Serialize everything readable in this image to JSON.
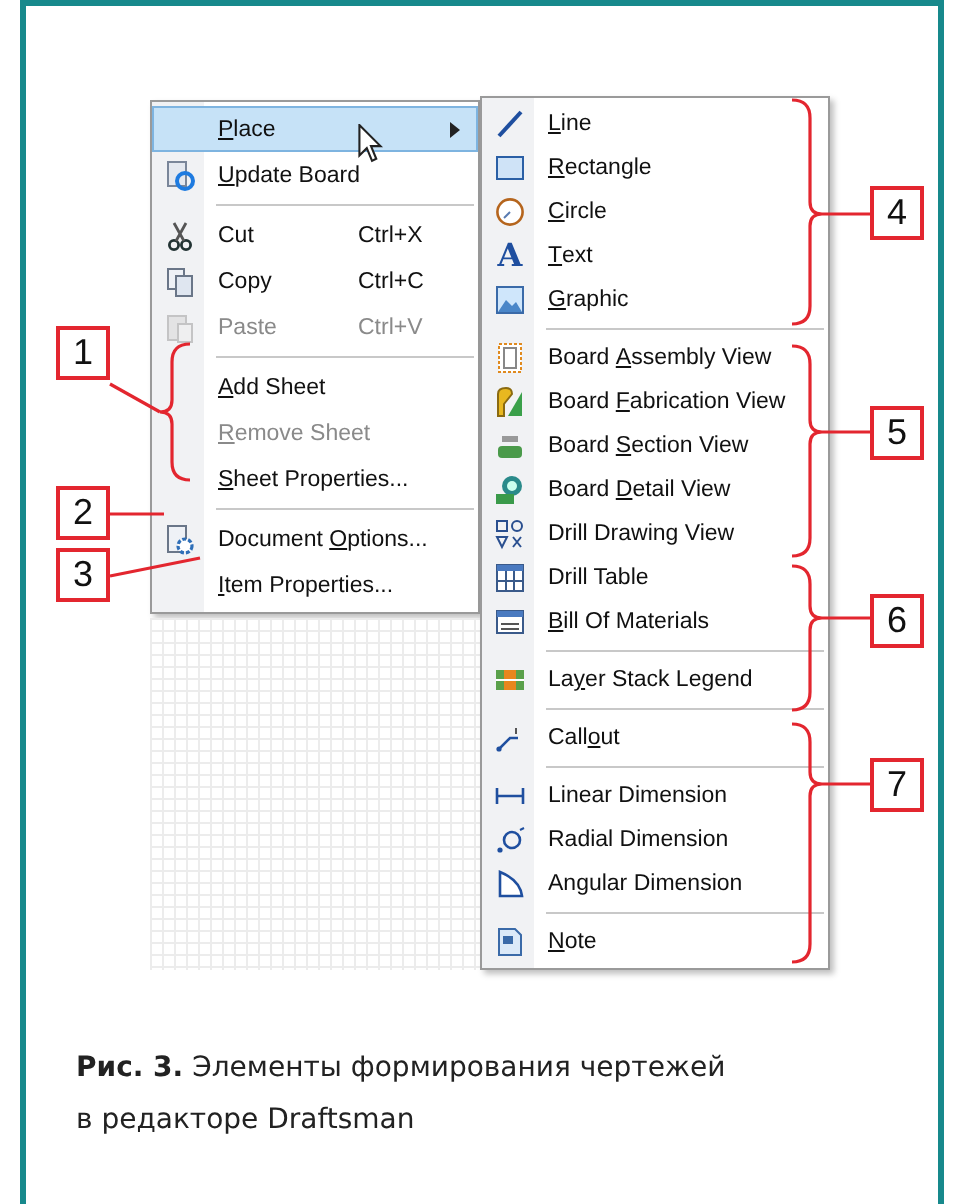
{
  "main_menu": {
    "items": [
      {
        "kind": "item",
        "key": "P",
        "post": "lace",
        "has_submenu": true,
        "highlighted": true,
        "disabled": false
      },
      {
        "kind": "item",
        "key": "U",
        "post": "pdate Board",
        "has_submenu": false,
        "highlighted": false,
        "disabled": false
      },
      {
        "kind": "separator"
      },
      {
        "kind": "item",
        "pre": "Cut",
        "shortcut": "Ctrl+X",
        "has_submenu": false,
        "highlighted": false,
        "disabled": false
      },
      {
        "kind": "item",
        "pre": "Copy",
        "shortcut": "Ctrl+C",
        "has_submenu": false,
        "highlighted": false,
        "disabled": false
      },
      {
        "kind": "item",
        "pre": "Paste",
        "shortcut": "Ctrl+V",
        "has_submenu": false,
        "highlighted": false,
        "disabled": true
      },
      {
        "kind": "separator"
      },
      {
        "kind": "item",
        "key": "A",
        "post": "dd Sheet",
        "has_submenu": false,
        "highlighted": false,
        "disabled": false
      },
      {
        "kind": "item",
        "key": "R",
        "post": "emove Sheet",
        "has_submenu": false,
        "highlighted": false,
        "disabled": true
      },
      {
        "kind": "item",
        "key": "S",
        "post": "heet Properties...",
        "has_submenu": false,
        "highlighted": false,
        "disabled": false
      },
      {
        "kind": "separator"
      },
      {
        "kind": "item",
        "pre": "Document ",
        "key": "O",
        "post": "ptions...",
        "has_submenu": false,
        "highlighted": false,
        "disabled": false
      },
      {
        "kind": "item",
        "key": "I",
        "post": "tem Properties...",
        "has_submenu": false,
        "highlighted": false,
        "disabled": false
      }
    ]
  },
  "submenu": {
    "items": [
      {
        "kind": "item",
        "key": "L",
        "post": "ine"
      },
      {
        "kind": "item",
        "key": "R",
        "post": "ectangle"
      },
      {
        "kind": "item",
        "key": "C",
        "post": "ircle"
      },
      {
        "kind": "item",
        "key": "T",
        "post": "ext",
        "icon_glyph": "A"
      },
      {
        "kind": "item",
        "key": "G",
        "post": "raphic"
      },
      {
        "kind": "separator"
      },
      {
        "kind": "item",
        "pre": "Board ",
        "key": "A",
        "post": "ssembly View"
      },
      {
        "kind": "item",
        "pre": "Board ",
        "key": "F",
        "post": "abrication View"
      },
      {
        "kind": "item",
        "pre": "Board ",
        "key": "S",
        "post": "ection View"
      },
      {
        "kind": "item",
        "pre": "Board ",
        "key": "D",
        "post": "etail View"
      },
      {
        "kind": "item",
        "pre": "Drill Drawing View"
      },
      {
        "kind": "item",
        "pre": "Drill Table"
      },
      {
        "kind": "item",
        "key": "B",
        "post": "ill Of Materials"
      },
      {
        "kind": "separator"
      },
      {
        "kind": "item",
        "pre": "La",
        "key": "y",
        "post": "er Stack Legend"
      },
      {
        "kind": "separator"
      },
      {
        "kind": "item",
        "pre": "Call",
        "key": "o",
        "post": "ut"
      },
      {
        "kind": "separator"
      },
      {
        "kind": "item",
        "pre": "Linear Dimension"
      },
      {
        "kind": "item",
        "pre": "Radial Dimension"
      },
      {
        "kind": "item",
        "pre": "Angular Dimension"
      },
      {
        "kind": "separator"
      },
      {
        "kind": "item",
        "key": "N",
        "post": "ote"
      }
    ]
  },
  "callouts": [
    {
      "label": "1"
    },
    {
      "label": "2"
    },
    {
      "label": "3"
    },
    {
      "label": "4"
    },
    {
      "label": "5"
    },
    {
      "label": "6"
    },
    {
      "label": "7"
    }
  ],
  "caption": "**Рис. 3.** Элементы формирования чертежей\nв редакторе Draftsman"
}
